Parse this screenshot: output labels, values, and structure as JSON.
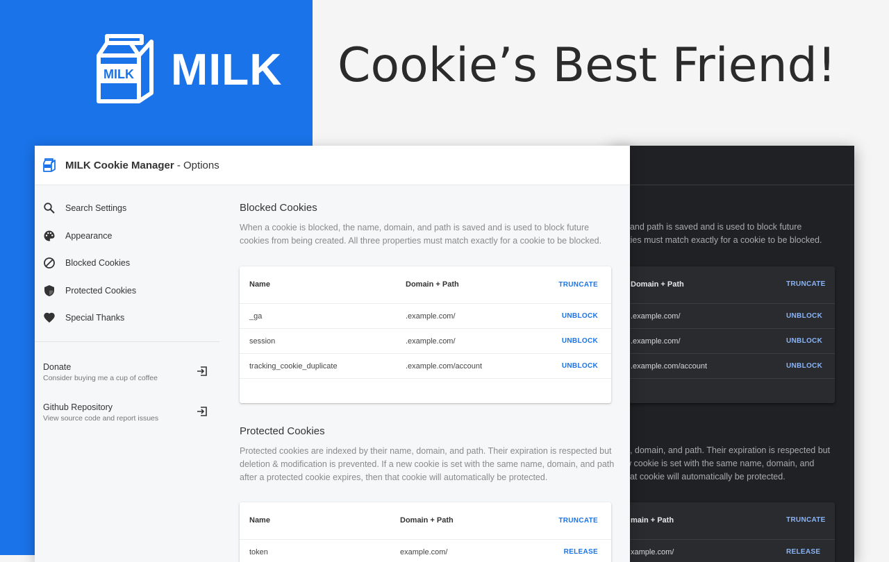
{
  "brand": {
    "carton_label": "MILK",
    "wordmark": "MILK"
  },
  "headline": "Cookie’s Best Friend!",
  "window": {
    "title_bold": "MILK Cookie Manager",
    "title_rest": " - Options"
  },
  "sidebar": {
    "items": [
      {
        "label": "Search Settings",
        "icon": "search-icon"
      },
      {
        "label": "Appearance",
        "icon": "palette-icon"
      },
      {
        "label": "Blocked Cookies",
        "icon": "block-icon"
      },
      {
        "label": "Protected Cookies",
        "icon": "shield-icon"
      },
      {
        "label": "Special Thanks",
        "icon": "heart-icon"
      }
    ],
    "links": [
      {
        "title": "Donate",
        "subtitle": "Consider buying me a cup of coffee",
        "icon": "open-in-icon"
      },
      {
        "title": "Github Repository",
        "subtitle": "View source code and report issues",
        "icon": "open-in-icon"
      }
    ]
  },
  "blocked": {
    "title": "Blocked Cookies",
    "description": "When a cookie is blocked, the name, domain, and path is saved and is used to block future cookies from being created. All three properties must match exactly for a cookie to be blocked.",
    "col_name": "Name",
    "col_domain": "Domain + Path",
    "header_action": "TRUNCATE",
    "rows": [
      {
        "name": "_ga",
        "domain": ".example.com/",
        "action": "UNBLOCK"
      },
      {
        "name": "session",
        "domain": ".example.com/",
        "action": "UNBLOCK"
      },
      {
        "name": "tracking_cookie_duplicate",
        "domain": ".example.com/account",
        "action": "UNBLOCK"
      }
    ]
  },
  "protected": {
    "title": "Protected Cookies",
    "description": "Protected cookies are indexed by their name, domain, and path. Their expiration is respected but deletion & modification is prevented. If a new cookie is set with the same name, domain, and path after a protected cookie expires, then that cookie will automatically be protected.",
    "col_name": "Name",
    "col_domain": "Domain + Path",
    "header_action": "TRUNCATE",
    "rows": [
      {
        "name": "token",
        "domain": "example.com/",
        "action": "RELEASE"
      }
    ]
  },
  "dark": {
    "blocked_desc_lines": [
      ", and path is saved and is used to block future",
      "rties must match exactly for a cookie to be blocked."
    ],
    "blocked_col_domain": "Domain + Path",
    "blocked_action": "TRUNCATE",
    "blocked_rows": [
      {
        "domain": ".example.com/",
        "action": "UNBLOCK"
      },
      {
        "domain": ".example.com/",
        "action": "UNBLOCK"
      },
      {
        "domain": ".example.com/account",
        "action": "UNBLOCK"
      }
    ],
    "protected_desc_lines": [
      "e, domain, and path. Their expiration is respected but",
      "w cookie is set with the same name, domain, and",
      "hat cookie will automatically be protected."
    ],
    "protected_col_domain": "main + Path",
    "protected_action": "TRUNCATE",
    "protected_rows": [
      {
        "domain": "xample.com/",
        "action": "RELEASE"
      }
    ]
  },
  "colors": {
    "brand_blue": "#1a73e8",
    "dark_bg": "#202124",
    "link_blue_dark": "#8ab4f8"
  }
}
